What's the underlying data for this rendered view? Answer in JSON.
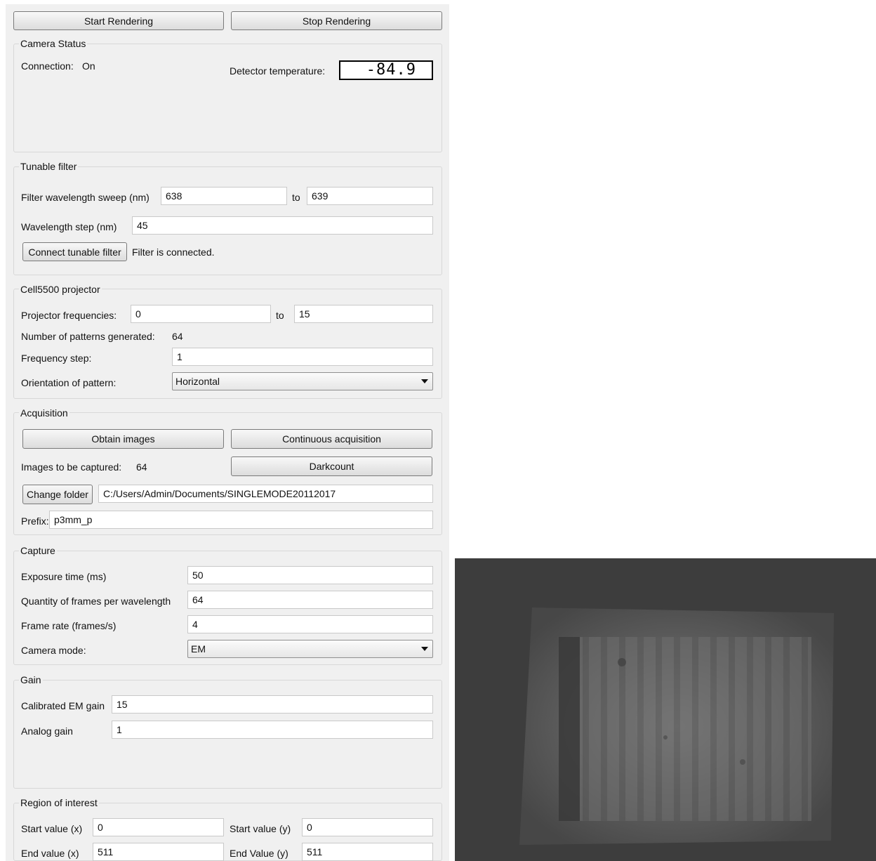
{
  "toolbar": {
    "start_label": "Start Rendering",
    "stop_label": "Stop Rendering"
  },
  "camera_status": {
    "title": "Camera Status",
    "connection_label": "Connection:",
    "connection_value": "On",
    "temperature_label": "Detector temperature:",
    "temperature_value": "-84.9"
  },
  "tunable_filter": {
    "title": "Tunable filter",
    "sweep_label": "Filter wavelength sweep (nm)",
    "sweep_from": "638",
    "to_label": "to",
    "sweep_to": "639",
    "step_label": "Wavelength step (nm)",
    "step_value": "45",
    "connect_label": "Connect tunable filter",
    "status_text": "Filter is connected."
  },
  "projector": {
    "title": "Cell5500 projector",
    "freq_label": "Projector frequencies:",
    "freq_from": "0",
    "to_label": "to",
    "freq_to": "15",
    "patterns_label": "Number of patterns generated:",
    "patterns_value": "64",
    "freq_step_label": "Frequency step:",
    "freq_step_value": "1",
    "orientation_label": "Orientation of pattern:",
    "orientation_value": "Horizontal"
  },
  "acquisition": {
    "title": "Acquisition",
    "obtain_label": "Obtain images",
    "continuous_label": "Continuous acquisition",
    "images_label": "Images to be captured:",
    "images_value": "64",
    "darkcount_label": "Darkcount",
    "change_folder_label": "Change folder",
    "folder_path": "C:/Users/Admin/Documents/SINGLEMODE20112017",
    "prefix_label": "Prefix:",
    "prefix_value": "p3mm_p"
  },
  "capture": {
    "title": "Capture",
    "exposure_label": "Exposure time (ms)",
    "exposure_value": "50",
    "frames_label": "Quantity of frames per wavelength",
    "frames_value": "64",
    "framerate_label": "Frame rate (frames/s)",
    "framerate_value": "4",
    "mode_label": "Camera mode:",
    "mode_value": "EM"
  },
  "gain": {
    "title": "Gain",
    "em_label": "Calibrated EM gain",
    "em_value": "15",
    "analog_label": "Analog gain",
    "analog_value": "1"
  },
  "roi": {
    "title": "Region of interest",
    "start_x_label": "Start value (x)",
    "start_x_value": "0",
    "start_y_label": "Start value (y)",
    "start_y_value": "0",
    "end_x_label": "End value (x)",
    "end_x_value": "511",
    "end_y_label": "End Value (y)",
    "end_y_value": "511"
  },
  "colors": {
    "panel_bg": "#f0f0f0",
    "viewer_bg": "#3d3d3d"
  }
}
